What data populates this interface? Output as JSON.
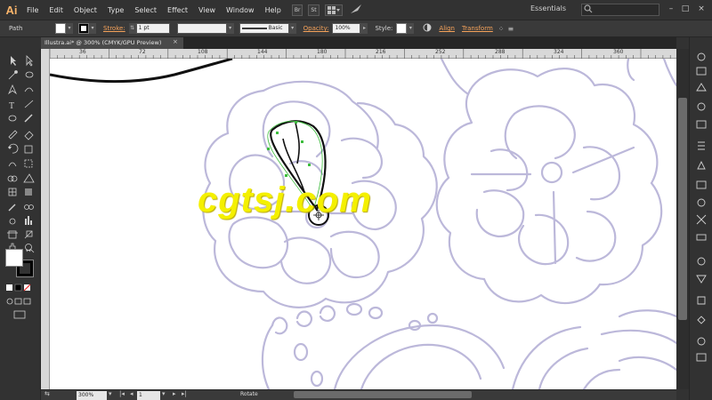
{
  "app": {
    "logo": "Ai"
  },
  "menu": [
    "File",
    "Edit",
    "Object",
    "Type",
    "Select",
    "Effect",
    "View",
    "Window",
    "Help"
  ],
  "menu_buttons": [
    "Br",
    "St"
  ],
  "workspace": "Essentials",
  "control": {
    "selection_type": "Path",
    "stroke_label": "Stroke:",
    "stroke_weight": "1 pt",
    "brush_profile": "Basic",
    "opacity_label": "Opacity:",
    "opacity_value": "100%",
    "style_label": "Style:",
    "align_label": "Align",
    "transform_label": "Transform"
  },
  "document": {
    "tab_title": "Illustra.ai* @ 300% (CMYK/GPU Preview)",
    "close": "×"
  },
  "ruler": {
    "ticks": [
      "36",
      "72",
      "108",
      "144",
      "180",
      "216",
      "252",
      "288",
      "324",
      "360"
    ]
  },
  "status": {
    "zoom": "300%",
    "artboard": "1",
    "tool_name": "Rotate"
  },
  "watermark": "cgtsj.com",
  "colors": {
    "accent": "#f5a25a",
    "sketch": "#b7b3d6",
    "selection": "#3dbd3d",
    "watermark": "#f4f000"
  }
}
